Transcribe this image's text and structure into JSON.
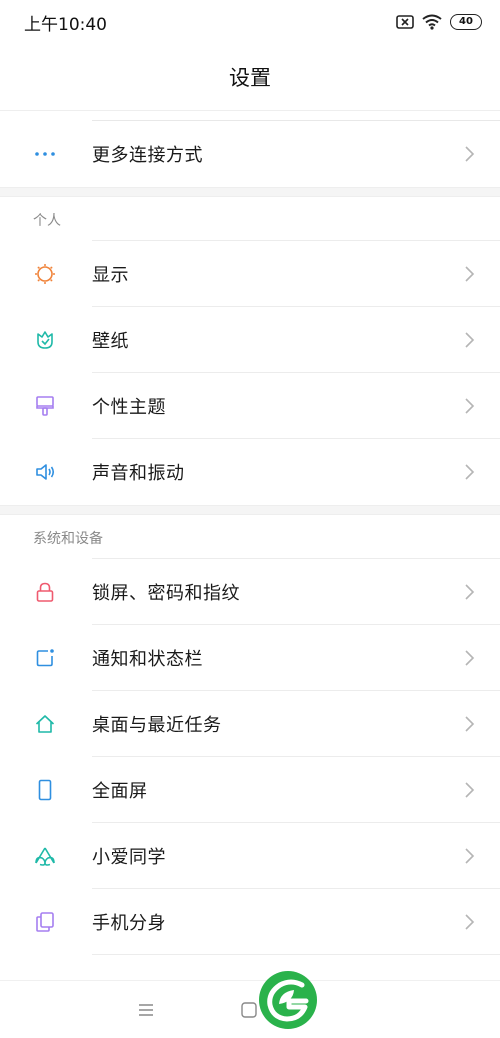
{
  "status_bar": {
    "time": "上午10:40",
    "battery": "40"
  },
  "header": {
    "title": "设置"
  },
  "connect": {
    "more_label": "更多连接方式"
  },
  "sections": {
    "personal_title": "个人",
    "system_title": "系统和设备"
  },
  "personal": {
    "display": "显示",
    "wallpaper": "壁纸",
    "themes": "个性主题",
    "sound": "声音和振动"
  },
  "system": {
    "lockscreen": "锁屏、密码和指纹",
    "notifications": "通知和状态栏",
    "home_screen": "桌面与最近任务",
    "fullscreen": "全面屏",
    "xiaoai": "小爱同学",
    "second_space": "手机分身"
  },
  "colors": {
    "blue": "#2f8fe0",
    "orange": "#f0833a",
    "teal": "#1fb9a8",
    "purple": "#a57ef0",
    "red": "#ef5a6f",
    "green": "#2ab24b"
  },
  "icons": {
    "more": "more-dots-icon",
    "display": "sun-icon",
    "wallpaper": "flower-icon",
    "themes": "brush-icon",
    "sound": "speaker-icon",
    "lockscreen": "lock-icon",
    "notifications": "notification-icon",
    "home_screen": "home-icon",
    "fullscreen": "phone-icon",
    "xiaoai": "xiaoai-icon",
    "second_space": "dual-app-icon"
  }
}
